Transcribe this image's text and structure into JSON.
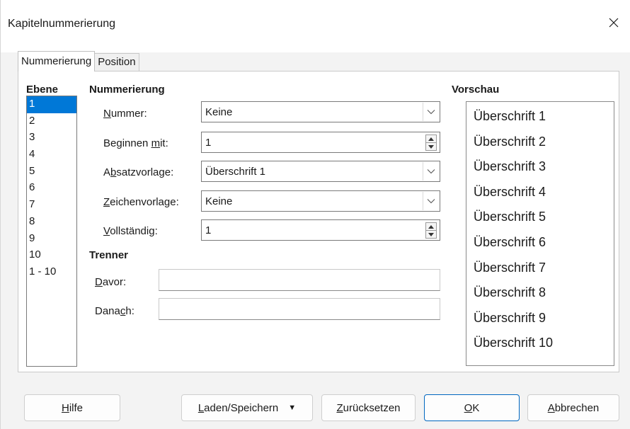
{
  "window": {
    "title": "Kapitelnummerierung"
  },
  "tabs": [
    {
      "label": "Nummerierung",
      "active": true
    },
    {
      "label": "Position",
      "active": false
    }
  ],
  "level": {
    "heading": "Ebene",
    "items": [
      "1",
      "2",
      "3",
      "4",
      "5",
      "6",
      "7",
      "8",
      "9",
      "10",
      "1 - 10"
    ],
    "selected_index": 0
  },
  "numbering": {
    "heading": "Nummerierung",
    "number": {
      "label_pre": "",
      "label_mn": "N",
      "label_post": "ummer:",
      "value": "Keine"
    },
    "start_at": {
      "label_pre": "Beginnen ",
      "label_mn": "m",
      "label_post": "it:",
      "value": "1"
    },
    "paragraph_style": {
      "label_pre": "A",
      "label_mn": "b",
      "label_post": "satzvorlage:",
      "value": "Überschrift 1"
    },
    "character_style": {
      "label_pre": "",
      "label_mn": "Z",
      "label_post": "eichenvorlage:",
      "value": "Keine"
    },
    "complete": {
      "label_pre": "",
      "label_mn": "V",
      "label_post": "ollständig:",
      "value": "1"
    }
  },
  "separator": {
    "heading": "Trenner",
    "before": {
      "label_pre": "",
      "label_mn": "D",
      "label_post": "avor:",
      "value": ""
    },
    "after": {
      "label_pre": "Dana",
      "label_mn": "c",
      "label_post": "h:",
      "value": ""
    }
  },
  "preview": {
    "heading": "Vorschau",
    "items": [
      "Überschrift 1",
      "Überschrift 2",
      "Überschrift 3",
      "Überschrift 4",
      "Überschrift 5",
      "Überschrift 6",
      "Überschrift 7",
      "Überschrift 8",
      "Überschrift 9",
      "Überschrift 10"
    ]
  },
  "buttons": {
    "help": {
      "pre": "",
      "mn": "H",
      "post": "ilfe"
    },
    "load_save": {
      "pre": "",
      "mn": "L",
      "post": "aden/Speichern"
    },
    "reset": {
      "pre": "",
      "mn": "Z",
      "post": "urücksetzen"
    },
    "ok": {
      "pre": "",
      "mn": "O",
      "post": "K"
    },
    "cancel": {
      "pre": "",
      "mn": "A",
      "post": "bbrechen"
    }
  },
  "colors": {
    "selection": "#0078d7",
    "default_button_border": "#0067c0"
  },
  "icons": {
    "close": "close-icon",
    "combo_arrow": "chevron-down-icon",
    "spin": "spin-arrows-icon",
    "menu_caret": "caret-down-icon"
  }
}
